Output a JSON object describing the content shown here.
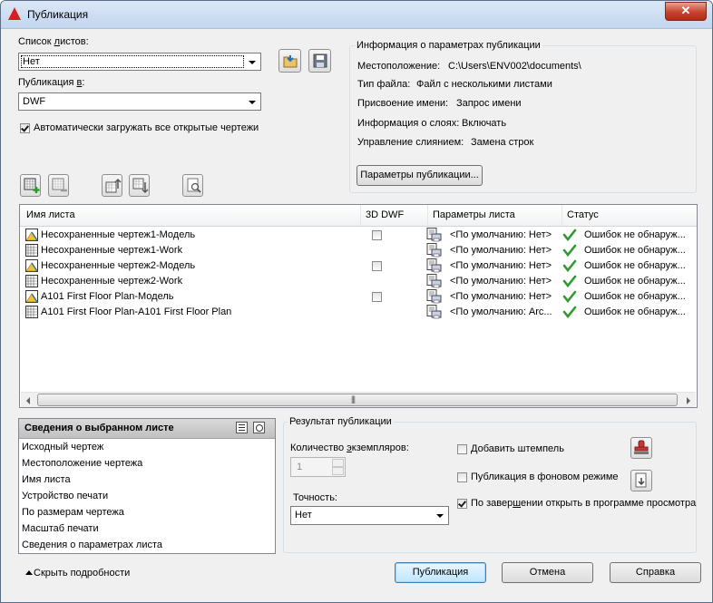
{
  "window": {
    "title": "Публикация",
    "close": "✕"
  },
  "sheet_list": {
    "label_pre": "Список ",
    "label_u": "л",
    "label_post": "истов:",
    "value": "Нет"
  },
  "publish_to": {
    "label_pre": "Публикация ",
    "label_u": "в",
    "label_post": ":",
    "value": "DWF"
  },
  "auto_load": {
    "label": "Автоматически загружать все открытые чертежи",
    "checked": true
  },
  "info": {
    "title": "Информация о параметрах публикации",
    "location_label": "Местоположение:",
    "location_value": "C:\\Users\\ENV002\\documents\\",
    "filetype_label": "Тип файла:",
    "filetype_value": "Файл с несколькими листами",
    "naming_label": "Присвоение имени:",
    "naming_value": "Запрос имени",
    "layers_label": "Информация о слоях:",
    "layers_value": "Включать",
    "merge_label": "Управление слиянием:",
    "merge_value": "Замена строк",
    "options_button": "Параметры публикации..."
  },
  "table": {
    "columns": [
      "Имя листа",
      "3D DWF",
      "Параметры листа",
      "Статус"
    ],
    "rows": [
      {
        "name": "Несохраненные чертеж1-Модель",
        "kind": "model",
        "dwf3d": true,
        "setup": "<По умолчанию: Нет>",
        "status": "Ошибок не обнаруж..."
      },
      {
        "name": "Несохраненные чертеж1-Work",
        "kind": "layout",
        "dwf3d": false,
        "setup": "<По умолчанию: Нет>",
        "status": "Ошибок не обнаруж..."
      },
      {
        "name": "Несохраненные чертеж2-Модель",
        "kind": "model",
        "dwf3d": true,
        "setup": "<По умолчанию: Нет>",
        "status": "Ошибок не обнаруж..."
      },
      {
        "name": "Несохраненные чертеж2-Work",
        "kind": "layout",
        "dwf3d": false,
        "setup": "<По умолчанию: Нет>",
        "status": "Ошибок не обнаруж..."
      },
      {
        "name": "A101 First Floor Plan-Модель",
        "kind": "model",
        "dwf3d": true,
        "setup": "<По умолчанию: Нет>",
        "status": "Ошибок не обнаруж..."
      },
      {
        "name": "A101 First Floor Plan-A101 First Floor Plan",
        "kind": "layout",
        "dwf3d": false,
        "setup": "<По умолчанию: Arc...",
        "status": "Ошибок не обнаруж..."
      }
    ],
    "scroll_grip": "|||"
  },
  "details": {
    "title": "Сведения о выбранном листе",
    "items": [
      "Исходный чертеж",
      "Местоположение чертежа",
      "Имя листа",
      "Устройство печати",
      "По размерам чертежа",
      "Масштаб печати",
      "Сведения о параметрах листа"
    ]
  },
  "output": {
    "title": "Результат публикации",
    "copies_pre": "Количество ",
    "copies_u": "э",
    "copies_post": "кземпляров:",
    "copies_value": "1",
    "precision_label": "Точность:",
    "precision_value": "Нет",
    "stamp_label_u": "Д",
    "stamp_label_rest": "обавить штемпель",
    "stamp_checked": false,
    "background_label": "Публикация в фоновом режиме",
    "background_checked": false,
    "viewer_pre": "По завер",
    "viewer_u": "ш",
    "viewer_post": "ении открыть в программе просмотра",
    "viewer_checked": true
  },
  "footer": {
    "hide_details": "Скрыть подробности",
    "publish": "Публикация",
    "cancel": "Отмена",
    "help": "Справка"
  },
  "icons": [
    "autocad-logo-icon",
    "load-sheet-list-icon",
    "save-sheet-list-icon",
    "add-sheets-icon",
    "remove-sheets-icon",
    "move-up-icon",
    "move-down-icon",
    "preview-icon",
    "model-sheet-icon",
    "layout-sheet-icon",
    "page-setup-icon",
    "no-errors-check-icon",
    "stamp-icon",
    "stamp-settings-icon"
  ]
}
